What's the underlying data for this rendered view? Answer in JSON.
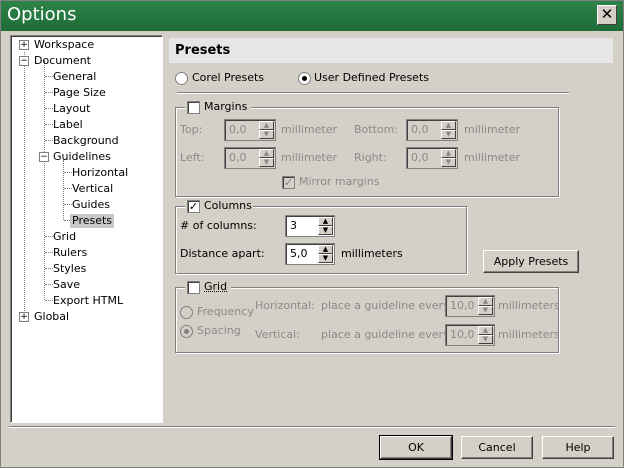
{
  "window": {
    "title": "Options"
  },
  "tree": {
    "workspace": "Workspace",
    "document": "Document",
    "general": "General",
    "page_size": "Page Size",
    "layout": "Layout",
    "label": "Label",
    "background": "Background",
    "guidelines": "Guidelines",
    "horizontal": "Horizontal",
    "vertical": "Vertical",
    "guides": "Guides",
    "presets": "Presets",
    "grid": "Grid",
    "rulers": "Rulers",
    "styles": "Styles",
    "save": "Save",
    "export_html": "Export HTML",
    "global": "Global",
    "expand_plus": "+",
    "expand_minus": "−"
  },
  "panel": {
    "title": "Presets",
    "corel_presets": "Corel Presets",
    "user_presets": "User Defined Presets",
    "margins": {
      "label": "Margins",
      "top": "Top:",
      "bottom": "Bottom:",
      "left": "Left:",
      "right": "Right:",
      "top_value": "0,0",
      "bottom_value": "0,0",
      "left_value": "0,0",
      "right_value": "0,0",
      "unit": "millimeter",
      "mirror": "Mirror margins"
    },
    "columns": {
      "label": "Columns",
      "num_label": "# of columns:",
      "num_value": "3",
      "dist_label": "Distance apart:",
      "dist_value": "5,0",
      "dist_unit": "millimeters"
    },
    "apply_presets": "Apply Presets",
    "grid": {
      "label": "Grid",
      "frequency": "Frequency",
      "spacing": "Spacing",
      "horizontal": "Horizontal:",
      "vertical": "Vertical:",
      "place_text": "place a guideline every",
      "h_value": "10,0",
      "v_value": "10,0",
      "unit": "millimeters"
    }
  },
  "buttons": {
    "ok": "OK",
    "cancel": "Cancel",
    "help": "Help"
  },
  "icons": {
    "close": "✕",
    "check": "✓",
    "up": "▲",
    "down": "▼"
  }
}
